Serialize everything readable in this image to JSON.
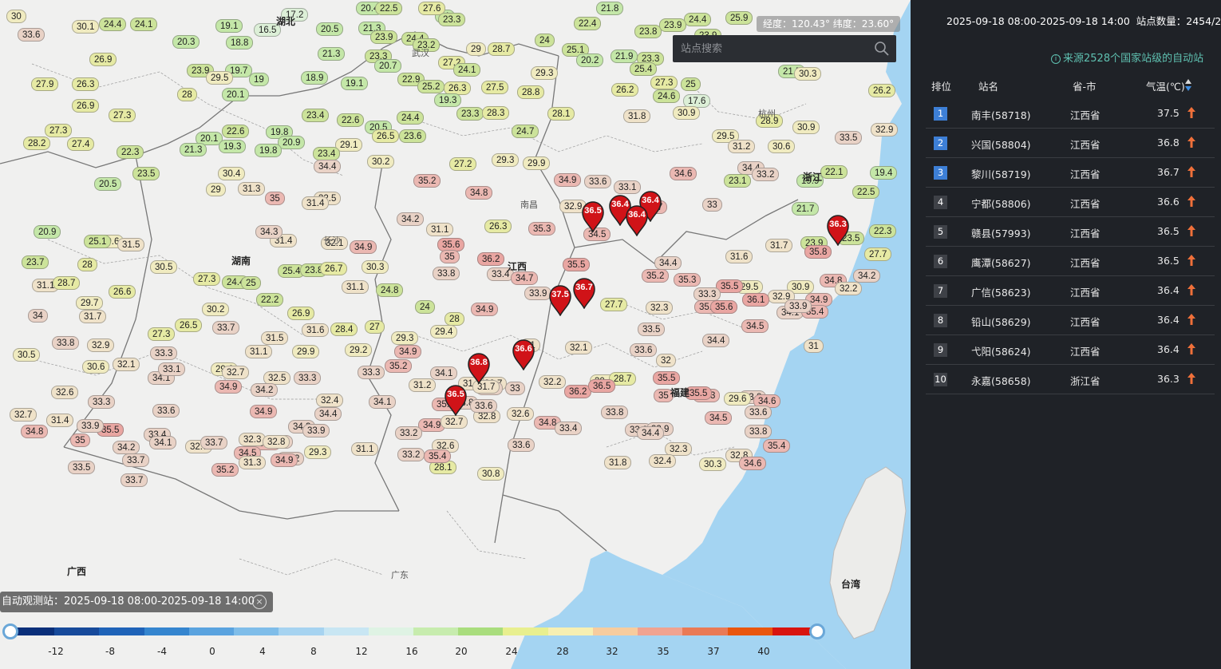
{
  "header": {
    "period": "2025-09-18 08:00-2025-09-18 14:00",
    "station_count_label": "站点数量：",
    "station_count": "2454/2528"
  },
  "source_note": "来源2528个国家站级的自动站",
  "coord_readout": "经度：120.43°  纬度：23.60°",
  "search": {
    "placeholder": "站点搜索"
  },
  "time_bar": "自动观测站：2025-09-18 08:00-2025-09-18 14:00",
  "table": {
    "headers": {
      "rank": "排位",
      "station": "站名",
      "region": "省-市",
      "temp": "气温(℃)"
    },
    "rows": [
      {
        "rank": "1",
        "station": "南丰(58718)",
        "region": "江西省",
        "temp": "37.5"
      },
      {
        "rank": "2",
        "station": "兴国(58804)",
        "region": "江西省",
        "temp": "36.8"
      },
      {
        "rank": "3",
        "station": "黎川(58719)",
        "region": "江西省",
        "temp": "36.7"
      },
      {
        "rank": "4",
        "station": "宁都(58806)",
        "region": "江西省",
        "temp": "36.6"
      },
      {
        "rank": "5",
        "station": "赣县(57993)",
        "region": "江西省",
        "temp": "36.5"
      },
      {
        "rank": "6",
        "station": "鹰潭(58627)",
        "region": "江西省",
        "temp": "36.5"
      },
      {
        "rank": "7",
        "station": "广信(58623)",
        "region": "江西省",
        "temp": "36.4"
      },
      {
        "rank": "8",
        "station": "铅山(58629)",
        "region": "江西省",
        "temp": "36.4"
      },
      {
        "rank": "9",
        "station": "弋阳(58624)",
        "region": "江西省",
        "temp": "36.4"
      },
      {
        "rank": "10",
        "station": "永嘉(58658)",
        "region": "浙江省",
        "temp": "36.3"
      }
    ]
  },
  "legend": {
    "ticks": [
      "-12",
      "-8",
      "-4",
      "0",
      "4",
      "8",
      "12",
      "16",
      "20",
      "24",
      "28",
      "32",
      "35",
      "37",
      "40"
    ],
    "colors": [
      "#0a2f7a",
      "#174a9b",
      "#1f63b8",
      "#3585cf",
      "#5aa3df",
      "#7fbde9",
      "#a6d3f0",
      "#c8e6f3",
      "#dff3e4",
      "#c7ecae",
      "#a9dd7d",
      "#e8ef8f",
      "#f7efb2",
      "#f7cc9e",
      "#f0a391",
      "#e97a56",
      "#e9560e",
      "#d8140f"
    ]
  },
  "map_labels": [
    "湖北",
    "武汉",
    "湖南",
    "江西",
    "南昌",
    "福建",
    "浙江",
    "台湾",
    "广西",
    "广东",
    "长沙",
    "杭州"
  ],
  "markers": [
    {
      "v": "36.5"
    },
    {
      "v": "36.4"
    },
    {
      "v": "36.4"
    },
    {
      "v": "36.4"
    },
    {
      "v": "36.3"
    },
    {
      "v": "37.5"
    },
    {
      "v": "36.7"
    },
    {
      "v": "36.6"
    },
    {
      "v": "36.8"
    },
    {
      "v": "36.5"
    }
  ],
  "pills": [
    "30",
    "24.4",
    "24.1",
    "17.2",
    "21",
    "20.4",
    "22.5",
    "27.6",
    "23.3",
    "21.8",
    "24.4",
    "25.9",
    "33.6",
    "30.1",
    "19.1",
    "16.5",
    "20.5",
    "21.3",
    "23.9",
    "24.4",
    "23.2",
    "29",
    "28.7",
    "24",
    "22.4",
    "23.8",
    "23.9",
    "23.9",
    "26.9",
    "20.3",
    "18.8",
    "21.3",
    "23.3",
    "27.2",
    "25.1",
    "20.2",
    "21.9",
    "23.3",
    "23.9",
    "19.7",
    "18.9",
    "20.7",
    "24.1",
    "29.3",
    "25.4",
    "21.5",
    "27.9",
    "26.3",
    "29.5",
    "19",
    "19.1",
    "22.9",
    "25.2",
    "26.3",
    "27.5",
    "28.8",
    "26.2",
    "27.3",
    "25",
    "26.2",
    "28",
    "20.1",
    "19.3",
    "26.9",
    "27.3",
    "23.4",
    "22.6",
    "23.3",
    "28.3",
    "28.1",
    "24.6",
    "17.6",
    "30.3",
    "27.3",
    "22.6",
    "19.8",
    "20.5",
    "24.4",
    "24.7",
    "31.8",
    "30.9",
    "28.9",
    "28.2",
    "27.4",
    "20.1",
    "20.9",
    "26.5",
    "23.6",
    "30.2",
    "29.1",
    "22.3",
    "21.3",
    "19.3",
    "19.8",
    "23.4",
    "27.2",
    "29.3",
    "29.9",
    "29.5",
    "31.2",
    "30.6",
    "30.9",
    "32.9",
    "33.5",
    "34.4",
    "33.2",
    "22.1",
    "19.4",
    "23.5",
    "30.4",
    "34.4",
    "35.2",
    "34.9",
    "33.6",
    "33.1",
    "34.6",
    "23.1",
    "19.9",
    "20.5",
    "29",
    "31.3",
    "35",
    "34.8",
    "32.9",
    "34.7",
    "33",
    "22.5",
    "21.7",
    "32.5",
    "31.4",
    "34.2",
    "31.1",
    "26.3",
    "23.5",
    "20.9",
    "29.6",
    "31.4",
    "32.1",
    "34.9",
    "35.6",
    "35.3",
    "34.5",
    "31.7",
    "23.9",
    "22.3",
    "25.1",
    "31.5",
    "34.3",
    "35",
    "36.2",
    "35.5",
    "34.4",
    "31.6",
    "27.7",
    "23.7",
    "28",
    "30.5",
    "30.3",
    "33.8",
    "35.3",
    "35.8",
    "34.2",
    "27.3",
    "24.4",
    "25",
    "25.4",
    "23.8",
    "26.7",
    "31.1",
    "33.4",
    "34.7",
    "35.2",
    "29.5",
    "30.9",
    "31.1",
    "28.7",
    "22.2",
    "24.8",
    "33.9",
    "35.5",
    "33.3",
    "34.8",
    "32.2",
    "29.7",
    "26.6",
    "24",
    "34.9",
    "35.2",
    "32.9",
    "34.9",
    "34",
    "31.7",
    "30.2",
    "26.9",
    "27",
    "28",
    "27.7",
    "32.3",
    "35.6",
    "36.1",
    "34.1",
    "35.4",
    "27.3",
    "26.5",
    "33.7",
    "31.5",
    "31.6",
    "28.4",
    "29.4",
    "31",
    "33.5",
    "33.9",
    "34.4",
    "34.5",
    "33.8",
    "32.9",
    "33.3",
    "31.1",
    "29.9",
    "29.2",
    "29.3",
    "34.9",
    "33.6",
    "31",
    "30.5",
    "30.6",
    "32.1",
    "29.6",
    "32.7",
    "35.2",
    "34.1",
    "32.7",
    "32.2",
    "32.1",
    "30.4",
    "28.7",
    "32",
    "32.6",
    "34.1",
    "33.1",
    "32.5",
    "33.3",
    "32.4",
    "33.3",
    "31.2",
    "31.7",
    "34.1",
    "33",
    "36.2",
    "36.5",
    "35",
    "35.3",
    "33.8",
    "32.7",
    "31.4",
    "33.3",
    "33.6",
    "34.9",
    "34.2",
    "34.4",
    "34.1",
    "35.2",
    "31.7",
    "35.5",
    "35.5",
    "29.6",
    "34.6",
    "34.8",
    "35",
    "35.5",
    "33.4",
    "34.9",
    "34.3",
    "34.9",
    "32.7",
    "32.8",
    "32.6",
    "34.8",
    "33.8",
    "33.6",
    "33.9",
    "34.2",
    "34.1",
    "34.5",
    "33.4",
    "33.9",
    "33.2",
    "32.6",
    "33.8",
    "33.6",
    "33.6",
    "33.4",
    "33.2",
    "33.9",
    "34.5",
    "33.8",
    "35.4",
    "33.5",
    "33.7",
    "32.7",
    "33.7",
    "34.5",
    "32.3",
    "32.8",
    "33.2",
    "31.1",
    "28.1",
    "34.4",
    "32.3",
    "32.8",
    "34.6",
    "33.7",
    "35.2",
    "31.3",
    "34.9",
    "29.3",
    "33.2",
    "35.4",
    "30.8",
    "31.8",
    "32.4",
    "30.3"
  ]
}
